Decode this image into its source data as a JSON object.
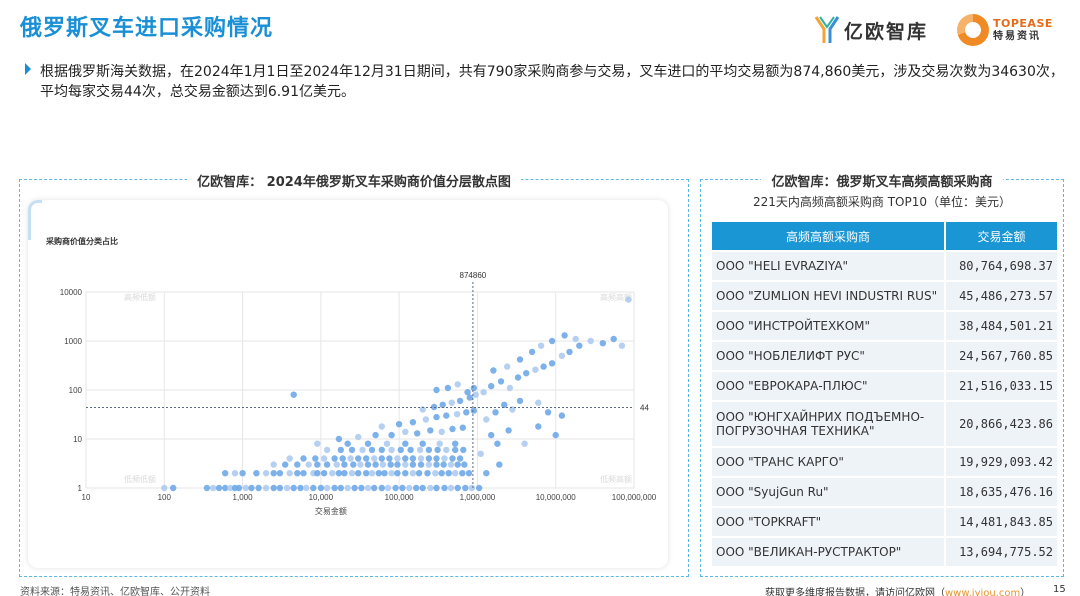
{
  "page": {
    "title": "俄罗斯叉车进口采购情况",
    "logo_yiou": "亿欧智库",
    "logo_topease_en": "TOPEASE",
    "logo_topease_cn": "特易资讯",
    "summary": "根据俄罗斯海关数据，在2024年1月1日至2024年12月31日期间，共有790家采购商参与交易，叉车进口的平均交易额为874,860美元，涉及交易次数为34630次，平均每家交易44次，总交易金额达到6.91亿美元。"
  },
  "left_panel": {
    "title": "亿欧智库： 2024年俄罗斯叉车采购商价值分层散点图",
    "subtitle": "采购商价值分类占比"
  },
  "right_panel": {
    "title": "亿欧智库：俄罗斯叉车高频高额采购商",
    "subtitle": "221天内高频高额采购商 TOP10（单位：美元）",
    "headers": [
      "高频高额采购商",
      "交易金额"
    ],
    "rows": [
      {
        "name": "OOO \"HELI EVRAZIYA\"",
        "amount": "80,764,698.37"
      },
      {
        "name": "OOO \"ZUMLION HEVI INDUSTRI RUS\"",
        "amount": "45,486,273.57"
      },
      {
        "name": "OOO \"ИНСТРОЙТЕХКОМ\"",
        "amount": "38,484,501.21"
      },
      {
        "name": "OOO \"НОБЛЕЛИФТ РУС\"",
        "amount": "24,567,760.85"
      },
      {
        "name": "OOO \"ЕВРОКАРА-ПЛЮС\"",
        "amount": "21,516,033.15"
      },
      {
        "name": "OOO \"ЮНГХАЙНРИХ ПОДЪЕМНО-ПОГРУЗОЧНАЯ ТЕХНИКА\"",
        "amount": "20,866,423.86"
      },
      {
        "name": "OOO \"ТРАНС КАРГО\"",
        "amount": "19,929,093.42"
      },
      {
        "name": "OOO \"SyujGun Ru\"",
        "amount": "18,635,476.16"
      },
      {
        "name": "OOO \"TOPKRAFT\"",
        "amount": "14,481,843.85"
      },
      {
        "name": "OOO \"ВЕЛИКАН-РУСТРАКТОР\"",
        "amount": "13,694,775.52"
      }
    ]
  },
  "footer": {
    "source": "资料来源：特易资讯、亿欧智库、公开资料",
    "more": "获取更多维度报告数据，请访问亿欧网（",
    "url": "www.iyiou.com",
    "more_end": "）",
    "page_no": "15"
  },
  "colors": {
    "accent": "#1a8fd6",
    "point": "#6fa8e8",
    "point_light": "#aecbef",
    "table_header": "#1a96d4"
  },
  "chart_data": {
    "type": "scatter",
    "title": "",
    "subtitle": "采购商价值分类占比",
    "xlabel": "交易金额",
    "ylabel": "",
    "x_scale": "log",
    "y_scale": "log",
    "xlim": [
      10,
      100000000
    ],
    "ylim": [
      1,
      10000
    ],
    "x_ticks": [
      {
        "v": 10,
        "label": "10"
      },
      {
        "v": 100,
        "label": "100"
      },
      {
        "v": 1000,
        "label": "1,000"
      },
      {
        "v": 10000,
        "label": "10,000"
      },
      {
        "v": 100000,
        "label": "100,000"
      },
      {
        "v": 1000000,
        "label": "1,000,000"
      },
      {
        "v": 10000000,
        "label": "10,000,000"
      },
      {
        "v": 100000000,
        "label": "100,000,000"
      }
    ],
    "y_ticks": [
      {
        "v": 1,
        "label": "1"
      },
      {
        "v": 10,
        "label": "10"
      },
      {
        "v": 100,
        "label": "100"
      },
      {
        "v": 1000,
        "label": "1000"
      },
      {
        "v": 10000,
        "label": "10000"
      }
    ],
    "ref_x": {
      "value": 874860,
      "label": "874860"
    },
    "ref_y": {
      "value": 44,
      "label": "44"
    },
    "quadrant_labels": {
      "top_left": "高频低额",
      "top_right": "高频高额",
      "bottom_left": "低频低额",
      "bottom_right": "低频高额"
    },
    "grid": true,
    "points": [
      [
        100,
        1
      ],
      [
        130,
        1
      ],
      [
        350,
        1
      ],
      [
        420,
        1
      ],
      [
        500,
        1
      ],
      [
        600,
        1
      ],
      [
        700,
        1
      ],
      [
        800,
        1
      ],
      [
        900,
        1
      ],
      [
        1100,
        1
      ],
      [
        1300,
        1
      ],
      [
        1600,
        1
      ],
      [
        2000,
        1
      ],
      [
        2500,
        1
      ],
      [
        3000,
        1
      ],
      [
        3700,
        1
      ],
      [
        4500,
        1
      ],
      [
        5500,
        1
      ],
      [
        6500,
        1
      ],
      [
        8000,
        1
      ],
      [
        10000,
        1
      ],
      [
        12000,
        1
      ],
      [
        15000,
        1
      ],
      [
        18000,
        1
      ],
      [
        22000,
        1
      ],
      [
        27000,
        1
      ],
      [
        33000,
        1
      ],
      [
        40000,
        1
      ],
      [
        48000,
        1
      ],
      [
        60000,
        1
      ],
      [
        72000,
        1
      ],
      [
        90000,
        1
      ],
      [
        110000,
        1
      ],
      [
        135000,
        1
      ],
      [
        165000,
        1
      ],
      [
        200000,
        1
      ],
      [
        250000,
        1
      ],
      [
        300000,
        1
      ],
      [
        380000,
        1
      ],
      [
        460000,
        1
      ],
      [
        560000,
        1
      ],
      [
        700000,
        1
      ],
      [
        850000,
        1
      ],
      [
        1050000,
        1
      ],
      [
        600,
        2
      ],
      [
        800,
        2
      ],
      [
        1000,
        2
      ],
      [
        1500,
        2
      ],
      [
        2000,
        2
      ],
      [
        2500,
        2
      ],
      [
        3000,
        2
      ],
      [
        4000,
        2
      ],
      [
        5000,
        2
      ],
      [
        6000,
        2
      ],
      [
        8000,
        2
      ],
      [
        9000,
        2
      ],
      [
        11000,
        2
      ],
      [
        14000,
        2
      ],
      [
        17000,
        2
      ],
      [
        20000,
        2
      ],
      [
        25000,
        2
      ],
      [
        30000,
        2
      ],
      [
        38000,
        2
      ],
      [
        45000,
        2
      ],
      [
        55000,
        2
      ],
      [
        65000,
        2
      ],
      [
        80000,
        2
      ],
      [
        95000,
        2
      ],
      [
        120000,
        2
      ],
      [
        150000,
        2
      ],
      [
        180000,
        2
      ],
      [
        230000,
        2
      ],
      [
        290000,
        2
      ],
      [
        350000,
        2
      ],
      [
        430000,
        2
      ],
      [
        520000,
        2
      ],
      [
        640000,
        2
      ],
      [
        780000,
        2
      ],
      [
        2500,
        3
      ],
      [
        3500,
        3
      ],
      [
        5000,
        3
      ],
      [
        7000,
        3
      ],
      [
        9000,
        3
      ],
      [
        12000,
        3
      ],
      [
        16000,
        3
      ],
      [
        20000,
        3
      ],
      [
        26000,
        3
      ],
      [
        32000,
        3
      ],
      [
        40000,
        3
      ],
      [
        50000,
        3
      ],
      [
        62000,
        3
      ],
      [
        78000,
        3
      ],
      [
        95000,
        3
      ],
      [
        120000,
        3
      ],
      [
        150000,
        3
      ],
      [
        190000,
        3
      ],
      [
        240000,
        3
      ],
      [
        300000,
        3
      ],
      [
        370000,
        3
      ],
      [
        460000,
        3
      ],
      [
        560000,
        3
      ],
      [
        680000,
        3
      ],
      [
        4000,
        4
      ],
      [
        6000,
        4
      ],
      [
        8500,
        4
      ],
      [
        11000,
        4
      ],
      [
        15000,
        4
      ],
      [
        19000,
        4
      ],
      [
        24000,
        4
      ],
      [
        30000,
        4
      ],
      [
        38000,
        4
      ],
      [
        48000,
        4
      ],
      [
        60000,
        4
      ],
      [
        75000,
        4
      ],
      [
        95000,
        4
      ],
      [
        120000,
        4
      ],
      [
        150000,
        4
      ],
      [
        190000,
        4
      ],
      [
        240000,
        4
      ],
      [
        300000,
        4
      ],
      [
        380000,
        4
      ],
      [
        480000,
        4
      ],
      [
        600000,
        4
      ],
      [
        12000,
        6
      ],
      [
        18000,
        6
      ],
      [
        25000,
        6
      ],
      [
        34000,
        6
      ],
      [
        45000,
        6
      ],
      [
        60000,
        6
      ],
      [
        80000,
        6
      ],
      [
        105000,
        6
      ],
      [
        140000,
        6
      ],
      [
        185000,
        6
      ],
      [
        240000,
        6
      ],
      [
        310000,
        6
      ],
      [
        400000,
        6
      ],
      [
        520000,
        6
      ],
      [
        660000,
        6
      ],
      [
        9000,
        8
      ],
      [
        22000,
        8
      ],
      [
        40000,
        8
      ],
      [
        70000,
        8
      ],
      [
        120000,
        8
      ],
      [
        200000,
        8
      ],
      [
        330000,
        8
      ],
      [
        520000,
        8
      ],
      [
        17000,
        10
      ],
      [
        30000,
        11
      ],
      [
        50000,
        12
      ],
      [
        80000,
        12
      ],
      [
        120000,
        14
      ],
      [
        170000,
        13
      ],
      [
        250000,
        15
      ],
      [
        350000,
        14
      ],
      [
        480000,
        16
      ],
      [
        650000,
        17
      ],
      [
        60000,
        18
      ],
      [
        100000,
        20
      ],
      [
        150000,
        22
      ],
      [
        220000,
        25
      ],
      [
        300000,
        28
      ],
      [
        400000,
        30
      ],
      [
        550000,
        32
      ],
      [
        720000,
        35
      ],
      [
        900000,
        38
      ],
      [
        200000,
        40
      ],
      [
        280000,
        45
      ],
      [
        360000,
        50
      ],
      [
        470000,
        55
      ],
      [
        600000,
        60
      ],
      [
        800000,
        70
      ],
      [
        950000,
        80
      ],
      [
        300000,
        100
      ],
      [
        420000,
        110
      ],
      [
        560000,
        130
      ],
      [
        750000,
        90
      ],
      [
        900000,
        110
      ],
      [
        1300000,
        25
      ],
      [
        1700000,
        35
      ],
      [
        2200000,
        50
      ],
      [
        2800000,
        40
      ],
      [
        3500000,
        60
      ],
      [
        4500,
        80
      ],
      [
        6000000,
        55
      ],
      [
        8000000,
        35
      ],
      [
        12000000,
        30
      ],
      [
        1200000,
        90
      ],
      [
        1500000,
        120
      ],
      [
        2000000,
        150
      ],
      [
        2600000,
        110
      ],
      [
        3300000,
        180
      ],
      [
        4200000,
        220
      ],
      [
        5500000,
        260
      ],
      [
        7000000,
        300
      ],
      [
        9000000,
        350
      ],
      [
        12000000,
        500
      ],
      [
        15000000,
        600
      ],
      [
        20000000,
        800
      ],
      [
        28000000,
        1000
      ],
      [
        40000000,
        900
      ],
      [
        55000000,
        1100
      ],
      [
        70000000,
        800
      ],
      [
        1500000,
        12
      ],
      [
        2500000,
        15
      ],
      [
        4000000,
        8
      ],
      [
        6000000,
        18
      ],
      [
        10000000,
        12
      ],
      [
        1100000,
        5
      ],
      [
        1800000,
        8
      ],
      [
        1600000,
        250
      ],
      [
        2400000,
        300
      ],
      [
        3500000,
        420
      ],
      [
        5000000,
        600
      ],
      [
        6500000,
        800
      ],
      [
        9000000,
        1000
      ],
      [
        13000000,
        1300
      ],
      [
        18000000,
        1100
      ],
      [
        1300000,
        2
      ],
      [
        1900000,
        3
      ],
      [
        85000000,
        7000
      ]
    ]
  }
}
